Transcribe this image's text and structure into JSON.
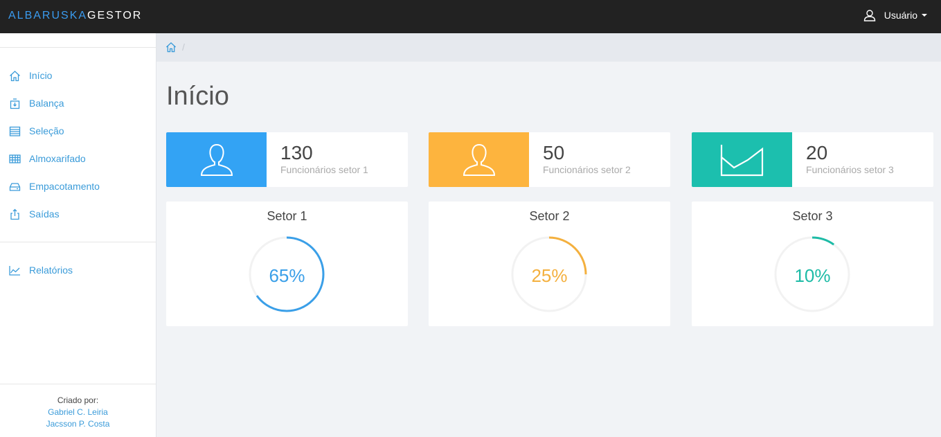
{
  "brand": {
    "part1": "ALBARUSKA",
    "part2": "GESTOR"
  },
  "user_menu": {
    "label": "Usuário"
  },
  "sidebar": {
    "items": [
      {
        "label": "Início",
        "icon": "home-icon"
      },
      {
        "label": "Balança",
        "icon": "scale-icon"
      },
      {
        "label": "Seleção",
        "icon": "calendar-icon"
      },
      {
        "label": "Almoxarifado",
        "icon": "grid-icon"
      },
      {
        "label": "Empacotamento",
        "icon": "package-icon"
      },
      {
        "label": "Saídas",
        "icon": "export-icon"
      }
    ],
    "reports": {
      "label": "Relatórios",
      "icon": "chart-line-icon"
    },
    "credits": {
      "label": "Criado por:",
      "author1": "Gabriel C. Leiria",
      "author2": "Jacsson P. Costa"
    }
  },
  "breadcrumb": {
    "separator": "/"
  },
  "page": {
    "title": "Início"
  },
  "stats": [
    {
      "value": "130",
      "label": "Funcionários setor 1",
      "color": "#33a3f4",
      "icon": "user-icon"
    },
    {
      "value": "50",
      "label": "Funcionários setor 2",
      "color": "#fdb43e",
      "icon": "user-icon"
    },
    {
      "value": "20",
      "label": "Funcionários setor 3",
      "color": "#1cbfae",
      "icon": "area-chart-icon"
    }
  ],
  "sectors": [
    {
      "title": "Setor 1",
      "percent_label": "65%",
      "percent": 65,
      "color": "#3a9fe8"
    },
    {
      "title": "Setor 2",
      "percent_label": "25%",
      "percent": 25,
      "color": "#f4b03e"
    },
    {
      "title": "Setor 3",
      "percent_label": "10%",
      "percent": 10,
      "color": "#1dbba6"
    }
  ]
}
